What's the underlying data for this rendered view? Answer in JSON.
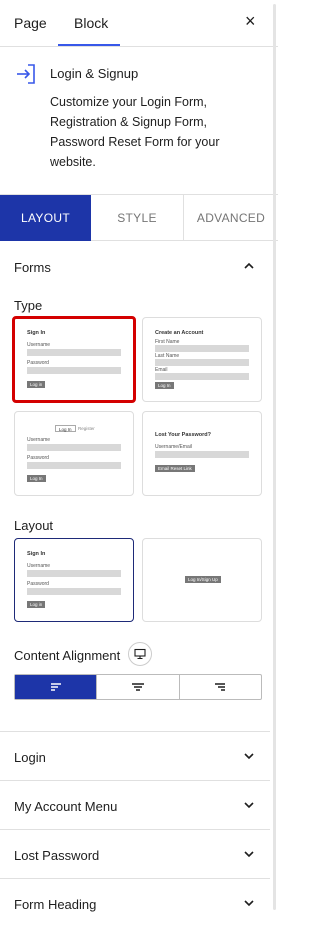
{
  "top_tabs": {
    "page": "Page",
    "block": "Block",
    "close": "×"
  },
  "block": {
    "title": "Login & Signup",
    "description": "Customize your Login Form, Registration & Signup Form, Password Reset Form for your website."
  },
  "settings_tabs": {
    "layout": "LAYOUT",
    "style": "STYLE",
    "advanced": "ADVANCED"
  },
  "forms_section": {
    "title": "Forms",
    "type_label": "Type",
    "layout_label": "Layout",
    "alignment_label": "Content Alignment",
    "type_cards": {
      "signin": {
        "title": "Sign In",
        "username": "Username",
        "password": "Password",
        "button": "Log in"
      },
      "create": {
        "title": "Create an Account",
        "first": "First Name",
        "last": "Last Name",
        "email": "Email",
        "button": "Log In"
      },
      "tabbed": {
        "tab_login": "Log In",
        "tab_register": "Register",
        "username": "Username",
        "password": "Password",
        "button": "Log In"
      },
      "lost": {
        "title": "Lost Your Password?",
        "field": "Username/Email",
        "button": "Email Reset Link"
      }
    },
    "layout_cards": {
      "form": {
        "title": "Sign In",
        "username": "Username",
        "password": "Password",
        "button": "Log in"
      },
      "button": {
        "button": "Log In/Sign Up"
      }
    }
  },
  "collapsed_sections": [
    "Login",
    "My Account Menu",
    "Lost Password",
    "Form Heading"
  ],
  "colors": {
    "accent": "#1d35a8",
    "selected_red": "#d40000",
    "wp_blue": "#3858e9"
  },
  "icons": [
    "login-icon",
    "close-icon",
    "chevron-up-icon",
    "chevron-down-icon",
    "desktop-icon",
    "align-left-icon",
    "align-center-icon",
    "align-right-icon"
  ]
}
